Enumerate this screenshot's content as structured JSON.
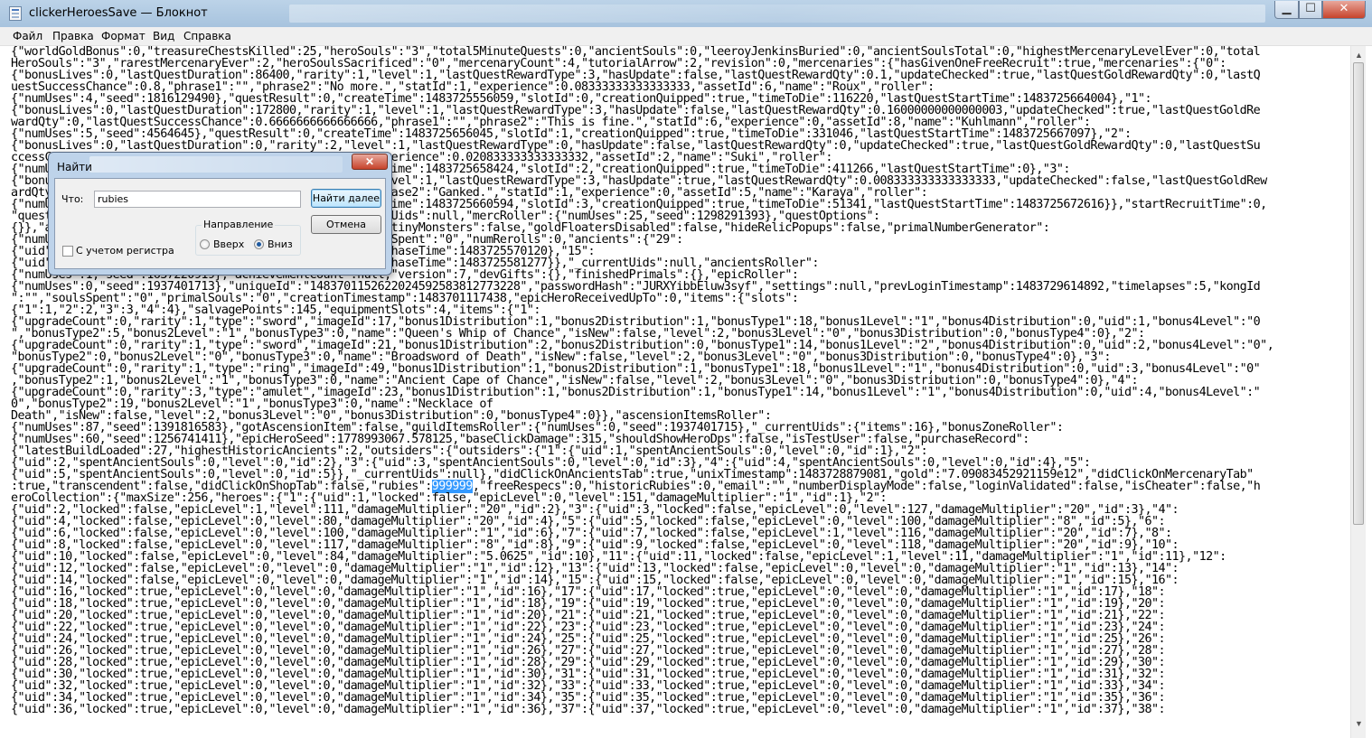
{
  "window": {
    "title": "clickerHeroesSave — Блокнот",
    "btn_minimize": "▁",
    "btn_maximize": "☐",
    "btn_close": "✕"
  },
  "menu": [
    "Файл",
    "Правка",
    "Формат",
    "Вид",
    "Справка"
  ],
  "editor": {
    "highlight": "999999",
    "lines_before": [
      "{\"worldGoldBonus\":0,\"treasureChestsKilled\":25,\"heroSouls\":\"3\",\"total5MinuteQuests\":0,\"ancientSouls\":0,\"leeroyJenkinsBuried\":0,\"ancientSoulsTotal\":0,\"highestMercenaryLevelEver\":0,\"total",
      "HeroSouls\":\"3\",\"rarestMercenaryEver\":2,\"heroSoulsSacrificed\":\"0\",\"mercenaryCount\":4,\"tutorialArrow\":2,\"revision\":0,\"mercenaries\":{\"hasGivenOneFreeRecruit\":true,\"mercenaries\":{\"0\":",
      "{\"bonusLives\":0,\"lastQuestDuration\":86400,\"rarity\":1,\"level\":1,\"lastQuestRewardType\":3,\"hasUpdate\":false,\"lastQuestRewardQty\":0.1,\"updateChecked\":true,\"lastQuestGoldRewardQty\":0,\"lastQ",
      "uestSuccessChance\":0.8,\"phrase1\":\"\",\"phrase2\":\"No more.\",\"statId\":1,\"experience\":0.08333333333333333,\"assetId\":6,\"name\":\"Roux\",\"roller\":",
      "{\"numUses\":4,\"seed\":1816129490},\"questResult\":0,\"createTime\":1483725556059,\"slotId\":0,\"creationQuipped\":true,\"timeToDie\":116220,\"lastQuestStartTime\":1483725664004},\"1\":",
      "{\"bonusLives\":0,\"lastQuestDuration\":172800,\"rarity\":1,\"level\":1,\"lastQuestRewardType\":3,\"hasUpdate\":false,\"lastQuestRewardQty\":0.16000000000000003,\"updateChecked\":true,\"lastQuestGoldRe",
      "wardQty\":0,\"lastQuestSuccessChance\":0.6666666666666666,\"phrase1\":\"\",\"phrase2\":\"This is fine.\",\"statId\":6,\"experience\":0,\"assetId\":8,\"name\":\"Kuhlmann\",\"roller\":",
      "{\"numUses\":5,\"seed\":4564645},\"questResult\":0,\"createTime\":1483725656045,\"slotId\":1,\"creationQuipped\":true,\"timeToDie\":331046,\"lastQuestStartTime\":1483725667097},\"2\":",
      "{\"bonusLives\":0,\"lastQuestDuration\":0,\"rarity\":2,\"level\":1,\"lastQuestRewardType\":0,\"hasUpdate\":false,\"lastQuestRewardQty\":0,\"updateChecked\":true,\"lastQuestGoldRewardQty\":0,\"lastQuestSu",
      "ccessChance\":0,\"phrase1\":\"\",\"phrase2\":\"\",\"statId\":1,\"experience\":0.020833333333333332,\"assetId\":2,\"name\":\"Suki\",\"roller\":",
      "{\"numUses\":4,\"seed\":1380545098},\"questResult\":0,\"createTime\":1483725658424,\"slotId\":2,\"creationQuipped\":true,\"timeToDie\":411266,\"lastQuestStartTime\":0},\"3\":",
      "{\"bonusLives\":0,\"lastQuestDuration\":86400,\"rarity\":1,\"level\":1,\"lastQuestRewardType\":3,\"hasUpdate\":true,\"lastQuestRewardQty\":0.008333333333333333,\"updateChecked\":false,\"lastQuestGoldRew",
      "ardQty\":0,\"lastQuestSuccessChance\":0.8,\"phrase1\":\"\",\"phrase2\":\"Ganked.\",\"statId\":1,\"experience\":0,\"assetId\":5,\"name\":\"Karaya\",\"roller\":",
      "{\"numUses\":4,\"seed\":1734529213},\"questResult\":1,\"createTime\":1483725660594,\"slotId\":3,\"creationQuipped\":true,\"timeToDie\":51341,\"lastQuestStartTime\":1483725672616}},\"startRecruitTime\":0,",
      "\"questOptions\":{\"numUses\":0,\"seed\":1258763254},\"_currentUids\":null,\"mercRoller\":{\"numUses\":25,\"seed\":1298291393},\"questOptions\":",
      "{}},\"ancientSoulsDisabled\":false,\"uniqueId\":1483701135,\"tinyMonsters\":false,\"goldFloatersDisabled\":false,\"hideRelicPopups\":false,\"primalNumberGenerator\":",
      "{\"numUses\":6,\"seed\":1765452817},\"rubiesSpent\":\"0\",\"soulsSpent\":\"0\",\"numRerolls\":0,\"ancients\":{\"29\":",
      "{\"uid\":29,\"level\":\"0\",\"spentHeroSouls\":\"4\",\"id\":29,\"purchaseTime\":1483725570120},\"15\":",
      "{\"uid\":15,\"level\":\"0\",\"spentHeroSouls\":\"6\",\"id\":15,\"purchaseTime\":1483725581277}},\"_currentUids\":null,\"ancientsRoller\":",
      "{\"numUses\":1,\"seed\":1637220919},\"achievementCount\":null,\"version\":7,\"devGifts\":{},\"finishedPrimals\":{},\"epicRoller\":",
      "{\"numUses\":0,\"seed\":1937401713},\"uniqueId\":\"1483701152622024592583812773228\",\"passwordHash\":\"JURXYibbEluw3syf\",\"settings\":null,\"prevLoginTimestamp\":1483729614892,\"timelapses\":5,\"kongId",
      "\":\"\",\"soulsSpent\":\"0\",\"primalSouls\":\"0\",\"creationTimestamp\":1483701117438,\"epicHeroReceivedUpTo\":0,\"items\":{\"slots\":",
      "{\"1\":1,\"2\":2,\"3\":3,\"4\":4},\"salvagePoints\":145,\"equipmentSlots\":4,\"items\":{\"1\":",
      "{\"upgradeCount\":0,\"rarity\":1,\"type\":\"sword\",\"imageId\":17,\"bonus1Distribution\":1,\"bonus2Distribution\":1,\"bonusType1\":18,\"bonus1Level\":\"1\",\"bonus4Distribution\":0,\"uid\":1,\"bonus4Level\":\"0",
      "\",\"bonusType2\":5,\"bonus2Level\":\"1\",\"bonusType3\":0,\"name\":\"Queen's Whip of Chance\",\"isNew\":false,\"level\":2,\"bonus3Level\":\"0\",\"bonus3Distribution\":0,\"bonusType4\":0},\"2\":",
      "{\"upgradeCount\":0,\"rarity\":1,\"type\":\"sword\",\"imageId\":21,\"bonus1Distribution\":2,\"bonus2Distribution\":0,\"bonusType1\":14,\"bonus1Level\":\"2\",\"bonus4Distribution\":0,\"uid\":2,\"bonus4Level\":\"0\",",
      "\"bonusType2\":0,\"bonus2Level\":\"0\",\"bonusType3\":0,\"name\":\"Broadsword of Death\",\"isNew\":false,\"level\":2,\"bonus3Level\":\"0\",\"bonus3Distribution\":0,\"bonusType4\":0},\"3\":",
      "{\"upgradeCount\":0,\"rarity\":1,\"type\":\"ring\",\"imageId\":49,\"bonus1Distribution\":1,\"bonus2Distribution\":1,\"bonusType1\":18,\"bonus1Level\":\"1\",\"bonus4Distribution\":0,\"uid\":3,\"bonus4Level\":\"0\"",
      ",\"bonusType2\":1,\"bonus2Level\":\"1\",\"bonusType3\":0,\"name\":\"Ancient Cape of Chance\",\"isNew\":false,\"level\":2,\"bonus3Level\":\"0\",\"bonus3Distribution\":0,\"bonusType4\":0},\"4\":",
      "{\"upgradeCount\":0,\"rarity\":3,\"type\":\"amulet\",\"imageId\":23,\"bonus1Distribution\":1,\"bonus2Distribution\":1,\"bonusType1\":14,\"bonus1Level\":\"1\",\"bonus4Distribution\":0,\"uid\":4,\"bonus4Level\":\"",
      "0\",\"bonusType2\":19,\"bonus2Level\":\"1\",\"bonusType3\":0,\"name\":\"Necklace of",
      "Death\",\"isNew\":false,\"level\":2,\"bonus3Level\":\"0\",\"bonus3Distribution\":0,\"bonusType4\":0}},\"ascensionItemsRoller\":",
      "{\"numUses\":87,\"seed\":1391816583},\"gotAscensionItem\":false,\"guildItemsRoller\":{\"numUses\":0,\"seed\":1937401715},\"_currentUids\":{\"items\":16},\"bonusZoneRoller\":",
      "{\"numUses\":60,\"seed\":1256741411},\"epicHeroSeed\":1778993067.578125,\"baseClickDamage\":315,\"shouldShowHeroDps\":false,\"isTestUser\":false,\"purchaseRecord\":",
      "{\"latestBuildLoaded\":27,\"highestHistoricAncients\":2,\"outsiders\":{\"outsiders\":{\"1\":{\"uid\":1,\"spentAncientSouls\":0,\"level\":0,\"id\":1},\"2\":",
      "{\"uid\":2,\"spentAncientSouls\":0,\"level\":0,\"id\":2},\"3\":{\"uid\":3,\"spentAncientSouls\":0,\"level\":0,\"id\":3},\"4\":{\"uid\":4,\"spentAncientSouls\":0,\"level\":0,\"id\":4},\"5\":",
      "{\"uid\":5,\"spentAncientSouls\":0,\"level\":0,\"id\":5}},\"_currentUids\":null},\"didClickOnAncientsTab\":true,\"unixTimestamp\":1483728879081,\"gold\":\"7.09083452921159e12\",\"didClickOnMercenaryTab\""
    ],
    "line_rubies_before": ":true,\"transcendent\":false,\"didClickOnShopTab\":false,\"rubies\":",
    "line_rubies_after": ",\"freeRespecs\":0,\"historicRubies\":0,\"email\":\"\",\"numberDisplayMode\":false,\"loginValidated\":false,\"isCheater\":false,\"h",
    "lines_after": [
      "eroCollection\":{\"maxSize\":256,\"heroes\":{\"1\":{\"uid\":1,\"locked\":false,\"epicLevel\":0,\"level\":151,\"damageMultiplier\":\"1\",\"id\":1},\"2\":",
      "{\"uid\":2,\"locked\":false,\"epicLevel\":1,\"level\":111,\"damageMultiplier\":\"20\",\"id\":2},\"3\":{\"uid\":3,\"locked\":false,\"epicLevel\":0,\"level\":127,\"damageMultiplier\":\"20\",\"id\":3},\"4\":",
      "{\"uid\":4,\"locked\":false,\"epicLevel\":0,\"level\":80,\"damageMultiplier\":\"20\",\"id\":4},\"5\":{\"uid\":5,\"locked\":false,\"epicLevel\":0,\"level\":100,\"damageMultiplier\":\"8\",\"id\":5},\"6\":",
      "{\"uid\":6,\"locked\":false,\"epicLevel\":0,\"level\":100,\"damageMultiplier\":\"1\",\"id\":6},\"7\":{\"uid\":7,\"locked\":false,\"epicLevel\":1,\"level\":116,\"damageMultiplier\":\"20\",\"id\":7},\"8\":",
      "{\"uid\":8,\"locked\":false,\"epicLevel\":0,\"level\":117,\"damageMultiplier\":\"8\",\"id\":8},\"9\":{\"uid\":9,\"locked\":false,\"epicLevel\":0,\"level\":118,\"damageMultiplier\":\"20\",\"id\":9},\"10\":",
      "{\"uid\":10,\"locked\":false,\"epicLevel\":0,\"level\":84,\"damageMultiplier\":\"5.0625\",\"id\":10},\"11\":{\"uid\":11,\"locked\":false,\"epicLevel\":1,\"level\":11,\"damageMultiplier\":\"1\",\"id\":11},\"12\":",
      "{\"uid\":12,\"locked\":false,\"epicLevel\":0,\"level\":0,\"damageMultiplier\":\"1\",\"id\":12},\"13\":{\"uid\":13,\"locked\":false,\"epicLevel\":0,\"level\":0,\"damageMultiplier\":\"1\",\"id\":13},\"14\":",
      "{\"uid\":14,\"locked\":false,\"epicLevel\":0,\"level\":0,\"damageMultiplier\":\"1\",\"id\":14},\"15\":{\"uid\":15,\"locked\":false,\"epicLevel\":0,\"level\":0,\"damageMultiplier\":\"1\",\"id\":15},\"16\":",
      "{\"uid\":16,\"locked\":true,\"epicLevel\":0,\"level\":0,\"damageMultiplier\":\"1\",\"id\":16},\"17\":{\"uid\":17,\"locked\":true,\"epicLevel\":0,\"level\":0,\"damageMultiplier\":\"1\",\"id\":17},\"18\":",
      "{\"uid\":18,\"locked\":true,\"epicLevel\":0,\"level\":0,\"damageMultiplier\":\"1\",\"id\":18},\"19\":{\"uid\":19,\"locked\":true,\"epicLevel\":0,\"level\":0,\"damageMultiplier\":\"1\",\"id\":19},\"20\":",
      "{\"uid\":20,\"locked\":true,\"epicLevel\":0,\"level\":0,\"damageMultiplier\":\"1\",\"id\":20},\"21\":{\"uid\":21,\"locked\":true,\"epicLevel\":0,\"level\":0,\"damageMultiplier\":\"1\",\"id\":21},\"22\":",
      "{\"uid\":22,\"locked\":true,\"epicLevel\":0,\"level\":0,\"damageMultiplier\":\"1\",\"id\":22},\"23\":{\"uid\":23,\"locked\":true,\"epicLevel\":0,\"level\":0,\"damageMultiplier\":\"1\",\"id\":23},\"24\":",
      "{\"uid\":24,\"locked\":true,\"epicLevel\":0,\"level\":0,\"damageMultiplier\":\"1\",\"id\":24},\"25\":{\"uid\":25,\"locked\":true,\"epicLevel\":0,\"level\":0,\"damageMultiplier\":\"1\",\"id\":25},\"26\":",
      "{\"uid\":26,\"locked\":true,\"epicLevel\":0,\"level\":0,\"damageMultiplier\":\"1\",\"id\":26},\"27\":{\"uid\":27,\"locked\":true,\"epicLevel\":0,\"level\":0,\"damageMultiplier\":\"1\",\"id\":27},\"28\":",
      "{\"uid\":28,\"locked\":true,\"epicLevel\":0,\"level\":0,\"damageMultiplier\":\"1\",\"id\":28},\"29\":{\"uid\":29,\"locked\":true,\"epicLevel\":0,\"level\":0,\"damageMultiplier\":\"1\",\"id\":29},\"30\":",
      "{\"uid\":30,\"locked\":true,\"epicLevel\":0,\"level\":0,\"damageMultiplier\":\"1\",\"id\":30},\"31\":{\"uid\":31,\"locked\":true,\"epicLevel\":0,\"level\":0,\"damageMultiplier\":\"1\",\"id\":31},\"32\":",
      "{\"uid\":32,\"locked\":true,\"epicLevel\":0,\"level\":0,\"damageMultiplier\":\"1\",\"id\":32},\"33\":{\"uid\":33,\"locked\":true,\"epicLevel\":0,\"level\":0,\"damageMultiplier\":\"1\",\"id\":33},\"34\":",
      "{\"uid\":34,\"locked\":true,\"epicLevel\":0,\"level\":0,\"damageMultiplier\":\"1\",\"id\":34},\"35\":{\"uid\":35,\"locked\":true,\"epicLevel\":0,\"level\":0,\"damageMultiplier\":\"1\",\"id\":35},\"36\":",
      "{\"uid\":36,\"locked\":true,\"epicLevel\":0,\"level\":0,\"damageMultiplier\":\"1\",\"id\":36},\"37\":{\"uid\":37,\"locked\":true,\"epicLevel\":0,\"level\":0,\"damageMultiplier\":\"1\",\"id\":37},\"38\":"
    ]
  },
  "scrollbar": {
    "up_arrow": "▲",
    "down_arrow": "▼"
  },
  "find_dialog": {
    "title": "Найти",
    "close_label": "✕",
    "what_label": "Что:",
    "search_value": "rubies",
    "find_next_label": "Найти далее",
    "cancel_label": "Отмена",
    "direction_label": "Направление",
    "up_label": "Вверх",
    "down_label": "Вниз",
    "direction_selected": "Вниз",
    "match_case_label": "С учетом регистра",
    "match_case_checked": false
  }
}
